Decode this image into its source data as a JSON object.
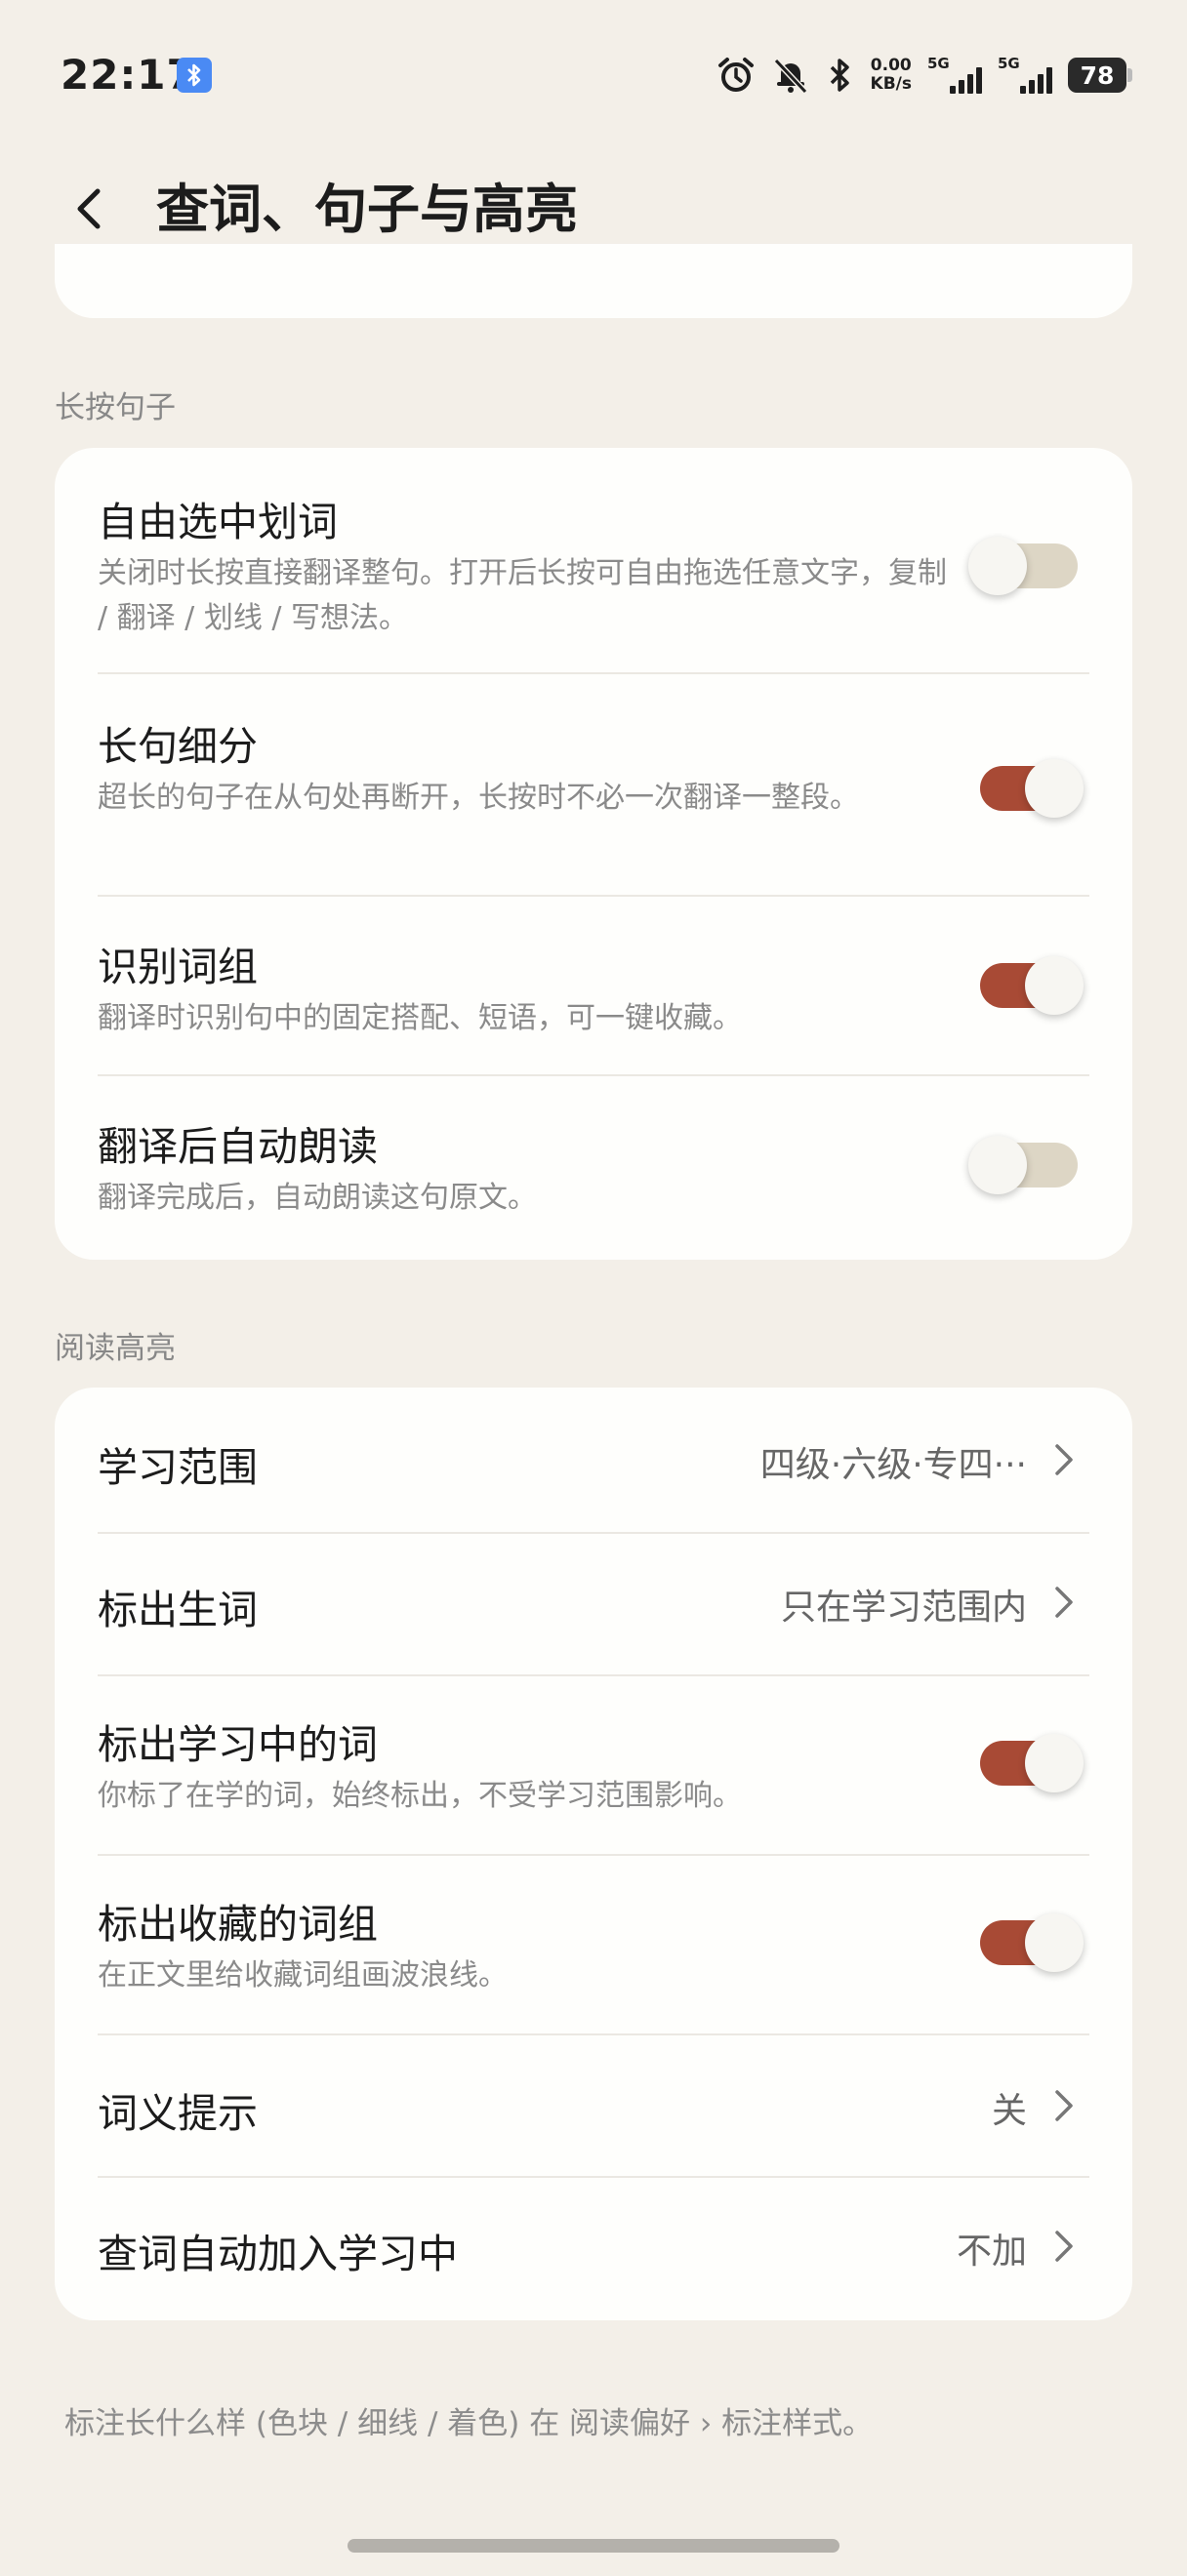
{
  "status_bar": {
    "time": "22:17",
    "net_speed_value": "0.00",
    "net_speed_unit": "KB/s",
    "sim1_tag": "5G",
    "sim2_tag": "5G",
    "battery": "78",
    "icons": [
      "bluetooth-badge-icon",
      "alarm-icon",
      "mute-icon",
      "bluetooth-icon",
      "signal-icon",
      "battery-icon"
    ]
  },
  "header": {
    "back_icon": "chevron-left-icon",
    "title": "查词、句子与高亮"
  },
  "long_press_section": {
    "title": "长按句子",
    "items": [
      {
        "title": "自由选中划词",
        "desc": "关闭时长按直接翻译整句。打开后长按可自由拖选任意文字，复制 / 翻译 / 划线 / 写想法。",
        "enabled": false
      },
      {
        "title": "长句细分",
        "desc": "超长的句子在从句处再断开，长按时不必一次翻译一整段。",
        "enabled": true
      },
      {
        "title": "识别词组",
        "desc": "翻译时识别句中的固定搭配、短语，可一键收藏。",
        "enabled": true
      },
      {
        "title": "翻译后自动朗读",
        "desc": "翻译完成后，自动朗读这句原文。",
        "enabled": false
      }
    ]
  },
  "highlight_section": {
    "title": "阅读高亮",
    "study_range": {
      "title": "学习范围",
      "value": "四级·六级·专四···"
    },
    "mark_new_words": {
      "title": "标出生词",
      "value": "只在学习范围内"
    },
    "mark_learning": {
      "title": "标出学习中的词",
      "desc": "你标了在学的词，始终标出，不受学习范围影响。",
      "enabled": true
    },
    "mark_phrases": {
      "title": "标出收藏的词组",
      "desc": "在正文里给收藏词组画波浪线。",
      "enabled": true
    },
    "meaning_hint": {
      "title": "词义提示",
      "value": "关"
    },
    "auto_add": {
      "title": "查词自动加入学习中",
      "value": "不加"
    }
  },
  "footer_note": "标注长什么样 (色块 / 细线 / 着色) 在 阅读偏好 › 标注样式。",
  "colors": {
    "background": "#f3efe8",
    "card": "#fefefc",
    "toggle_on": "#a84a35",
    "toggle_off": "#ddd6c5"
  }
}
